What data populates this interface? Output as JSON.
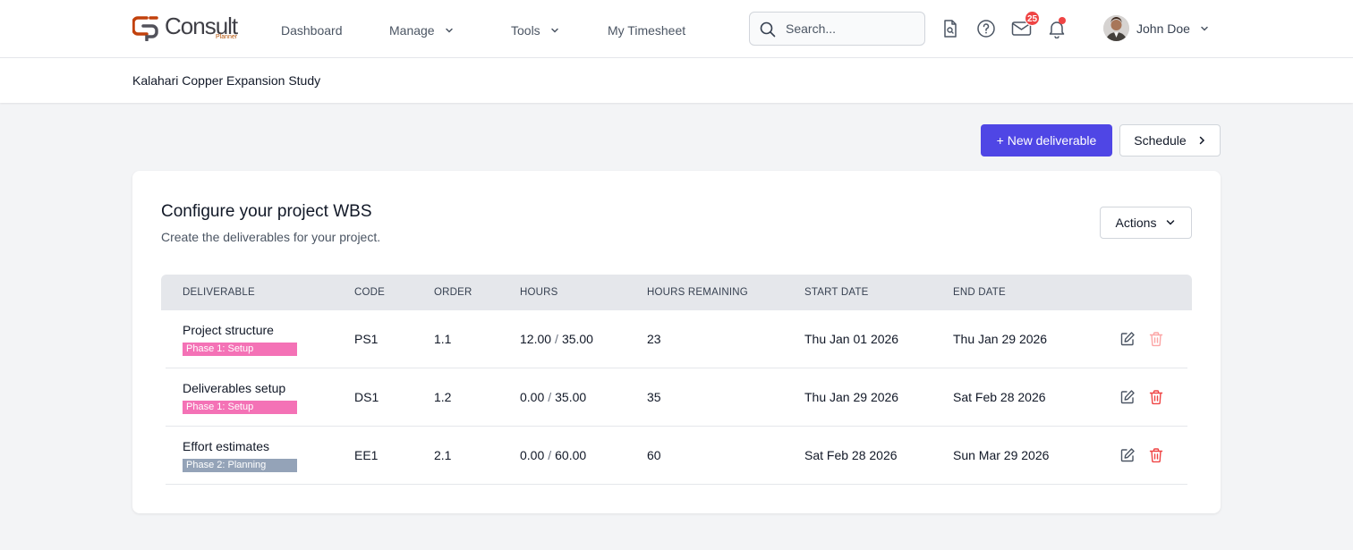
{
  "app": {
    "logo_word": "Consult",
    "logo_sub": "Planner"
  },
  "nav": {
    "items": [
      {
        "label": "Dashboard",
        "has_dropdown": false
      },
      {
        "label": "Manage",
        "has_dropdown": true
      },
      {
        "label": "Tools",
        "has_dropdown": true
      },
      {
        "label": "My Timesheet",
        "has_dropdown": false
      }
    ],
    "search_placeholder": "Search...",
    "mail_count": "25",
    "user_name": "John Doe"
  },
  "project": {
    "title": "Kalahari Copper Expansion Study"
  },
  "toolbar": {
    "new_deliverable_label": "+ New deliverable",
    "schedule_label": "Schedule"
  },
  "card": {
    "title": "Configure your project WBS",
    "subtitle": "Create the deliverables for your project.",
    "actions_label": "Actions"
  },
  "table": {
    "headers": [
      "DELIVERABLE",
      "CODE",
      "ORDER",
      "HOURS",
      "HOURS REMAINING",
      "START DATE",
      "END DATE"
    ],
    "rows": [
      {
        "name": "Project structure",
        "phase": "Phase 1: Setup",
        "code": "PS1",
        "order": "1.1",
        "hours_used": "12.00",
        "hours_total": "35.00",
        "remaining": "23",
        "start": "Thu Jan 01 2026",
        "end": "Thu Jan 29 2026"
      },
      {
        "name": "Deliverables setup",
        "phase": "Phase 1: Setup",
        "code": "DS1",
        "order": "1.2",
        "hours_used": "0.00",
        "hours_total": "35.00",
        "remaining": "35",
        "start": "Thu Jan 29 2026",
        "end": "Sat Feb 28 2026"
      },
      {
        "name": "Effort estimates",
        "phase": "Phase 2: Planning",
        "code": "EE1",
        "order": "2.1",
        "hours_used": "0.00",
        "hours_total": "60.00",
        "remaining": "60",
        "start": "Sat Feb 28 2026",
        "end": "Sun Mar 29 2026"
      }
    ],
    "hours_separator": "/"
  },
  "colors": {
    "primary": "#4f46e5",
    "phase1_tag": "#f472b6",
    "phase2_tag": "#94a3b8",
    "danger": "#ef4444",
    "danger_disabled": "#fca5a5",
    "logo_accent": "#c2410c"
  },
  "icons": {
    "search": "search-icon",
    "document": "document-search-icon",
    "help": "help-circle-icon",
    "mail": "mail-icon",
    "bell": "bell-icon",
    "chevron_down": "chevron-down-icon",
    "chevron_right": "chevron-right-icon",
    "edit": "edit-icon",
    "delete": "trash-icon"
  }
}
